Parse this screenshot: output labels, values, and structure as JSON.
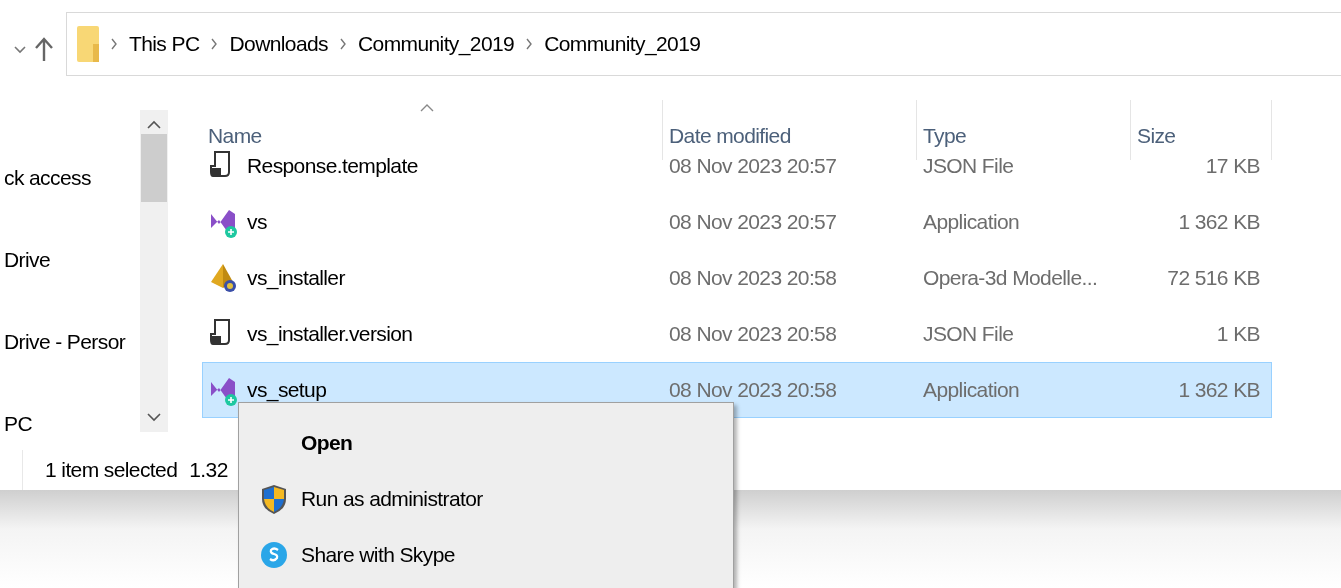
{
  "navigation": {
    "breadcrumbs": [
      "This PC",
      "Downloads",
      "Community_2019",
      "Community_2019"
    ]
  },
  "sidebar": {
    "items": [
      {
        "label": "ck access"
      },
      {
        "label": "Drive"
      },
      {
        "label": "Drive - Persor"
      },
      {
        "label": "PC"
      }
    ]
  },
  "file_list": {
    "columns": [
      {
        "label": "Name",
        "sorted": true
      },
      {
        "label": "Date modified",
        "sorted": false
      },
      {
        "label": "Type",
        "sorted": false
      },
      {
        "label": "Size",
        "sorted": false
      }
    ],
    "rows": [
      {
        "kind": "document",
        "name": "Response.template",
        "date": "08 Nov 2023 20:57",
        "type": "JSON File",
        "size": "17 KB",
        "selected": false
      },
      {
        "kind": "app",
        "name": "vs",
        "date": "08 Nov 2023 20:57",
        "type": "Application",
        "size": "1 362 KB",
        "selected": false
      },
      {
        "kind": "model",
        "name": "vs_installer",
        "date": "08 Nov 2023 20:58",
        "type": "Opera-3d Modelle...",
        "size": "72 516 KB",
        "selected": false
      },
      {
        "kind": "document",
        "name": "vs_installer.version",
        "date": "08 Nov 2023 20:58",
        "type": "JSON File",
        "size": "1 KB",
        "selected": false
      },
      {
        "kind": "app",
        "name": "vs_setup",
        "date": "08 Nov 2023 20:58",
        "type": "Application",
        "size": "1 362 KB",
        "selected": true
      }
    ]
  },
  "status_bar": {
    "count": "1 item selected",
    "size": "1.32"
  },
  "context_menu": {
    "items": [
      {
        "label": "Open",
        "kind": "default"
      },
      {
        "label": "Run as administrator",
        "kind": "admin"
      },
      {
        "label": "Share with Skype",
        "kind": "share"
      }
    ]
  }
}
